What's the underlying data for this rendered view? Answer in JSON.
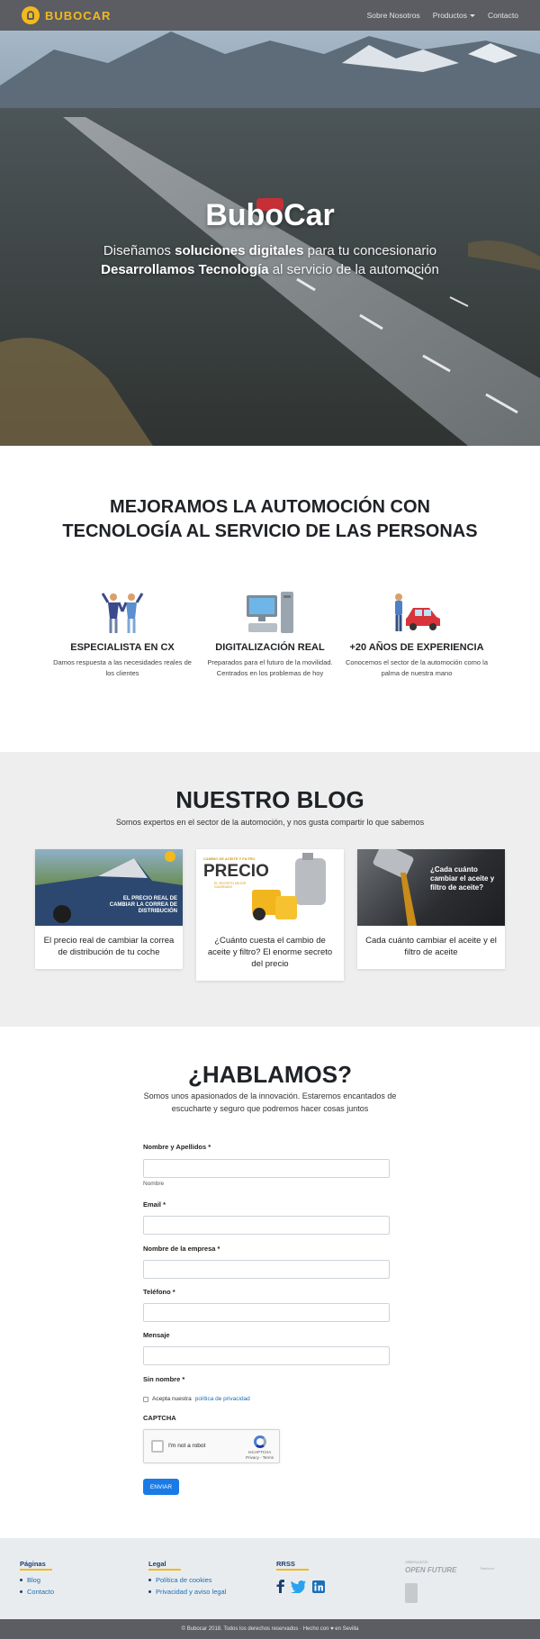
{
  "nav": {
    "logo_text": "BUBOCAR",
    "links": [
      "Sobre Nosotros",
      "Productos",
      "Contacto"
    ]
  },
  "hero": {
    "title": "BuboCar",
    "line1": {
      "pre": "Diseñamos ",
      "bold": "soluciones digitales",
      "post": " para tu concesionario"
    },
    "line2": {
      "bold": "Desarrollamos Tecnología",
      "post": " al servicio de la automoción"
    }
  },
  "mission": {
    "heading": "MEJORAMOS LA AUTOMOCIÓN CON TECNOLOGÍA AL SERVICIO DE LAS PERSONAS",
    "features": [
      {
        "icon": "people-icon",
        "title": "ESPECIALISTA EN CX",
        "text": "Damos respuesta a las necesidades reales de los clientes"
      },
      {
        "icon": "computer-icon",
        "title": "DIGITALIZACIÓN REAL",
        "text": "Preparados para el futuro de la movilidad. Centrados en los problemas de hoy"
      },
      {
        "icon": "car-icon",
        "title": "+20 AÑOS DE EXPERIENCIA",
        "text": "Conocemos el sector de la automoción como la palma de nuestra mano"
      }
    ]
  },
  "blog": {
    "heading": "NUESTRO BLOG",
    "subtitle": "Somos expertos en el sector de la automoción, y nos gusta compartir lo que sabemos",
    "posts": [
      {
        "title": "El precio real de cambiar la correa de distribución de tu coche",
        "thumb_text": "EL PRECIO REAL DE CAMBIAR LA CORREA DE DISTRIBUCIÓN"
      },
      {
        "title": "¿Cuánto cuesta el cambio de aceite y filtro? El enorme secreto del precio",
        "thumb_kicker": "CAMBIO DE ACEITE Y FILTRO",
        "thumb_text": "PRECIO",
        "thumb_sub": "EL SECRETO MEJOR GUARDADO"
      },
      {
        "title": "Cada cuánto cambiar el aceite y el filtro de aceite",
        "thumb_text": "¿Cada cuánto cambiar el aceite y filtro de aceite?"
      }
    ]
  },
  "contact": {
    "heading": "¿HABLAMOS?",
    "intro": "Somos unos apasionados de la innovación. Estaremos encantados de escucharte y seguro que podremos hacer cosas juntos",
    "fields": {
      "name_label": "Nombre y Apellidos *",
      "name_hint": "Nombre",
      "email_label": "Email *",
      "company_label": "Nombre de la empresa *",
      "phone_label": "Teléfono *",
      "message_label": "Mensaje",
      "surname_label": "Sin nombre *"
    },
    "privacy_text": "Acepta nuestra ",
    "privacy_link": "política de privacidad",
    "captcha_label": "CAPTCHA",
    "captcha_text": "I'm not a robot",
    "captcha_brand": "reCAPTCHA",
    "captcha_terms": "Privacy - Terms",
    "submit_label": "ENVIAR"
  },
  "footer": {
    "pages_title": "Páginas",
    "pages": [
      "Blog",
      "Contacto"
    ],
    "legal_title": "Legal",
    "legal": [
      "Política de cookies",
      "Privacidad y aviso legal"
    ],
    "rrss_title": "RRSS",
    "partner_small": "ANDALUCÍA",
    "partner_name": "OPEN FUTURE",
    "partner_mini": "Telefónica",
    "copyright": "© Bubocar 2018. Todos los derechos reservados · Hecho con ♥ en Sevilla"
  },
  "colors": {
    "brand_yellow": "#f3b91d",
    "nav_gray": "#5b5d63",
    "link_blue": "#1a6fb5",
    "button_blue": "#1a7be6"
  }
}
